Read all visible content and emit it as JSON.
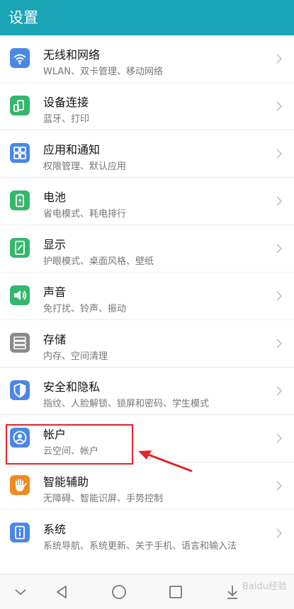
{
  "header": {
    "title": "设置",
    "bg_color": "#1aa6b7"
  },
  "items": [
    {
      "label": "无线和网络",
      "sub": "WLAN、双卡管理、移动网络",
      "icon": "wifi-icon",
      "color": "#4a87e6"
    },
    {
      "label": "设备连接",
      "sub": "蓝牙、打印",
      "icon": "device-connect-icon",
      "color": "#33b86b"
    },
    {
      "label": "应用和通知",
      "sub": "权限管理、默认应用",
      "icon": "apps-grid-icon",
      "color": "#4a87e6"
    },
    {
      "label": "电池",
      "sub": "省电模式、耗电排行",
      "icon": "battery-icon",
      "color": "#33b86b"
    },
    {
      "label": "显示",
      "sub": "护眼模式、桌面风格、壁纸",
      "icon": "display-icon",
      "color": "#33b86b"
    },
    {
      "label": "声音",
      "sub": "免打扰、铃声、振动",
      "icon": "sound-icon",
      "color": "#33b86b"
    },
    {
      "label": "存储",
      "sub": "内存、空间清理",
      "icon": "storage-icon",
      "color": "#8a8a8a"
    },
    {
      "label": "安全和隐私",
      "sub": "指纹、人脸解锁、锁屏和密码、学生模式",
      "icon": "shield-icon",
      "color": "#4a87e6"
    },
    {
      "label": "帐户",
      "sub": "云空间、帐户",
      "icon": "account-icon",
      "color": "#4a87e6"
    },
    {
      "label": "智能辅助",
      "sub": "无障碍、智能识屏、手势控制",
      "icon": "hand-icon",
      "color": "#f08a24"
    },
    {
      "label": "系统",
      "sub": "系统导航、系统更新、关于手机、语言和输入法",
      "icon": "info-icon",
      "color": "#4a87e6"
    }
  ],
  "annotation": {
    "color": "#e0242a"
  },
  "navbar": {
    "icons": [
      "chevron-down-icon",
      "back-icon",
      "home-icon",
      "recents-icon",
      "pull-down-icon"
    ]
  },
  "watermark": "Baidu经验"
}
